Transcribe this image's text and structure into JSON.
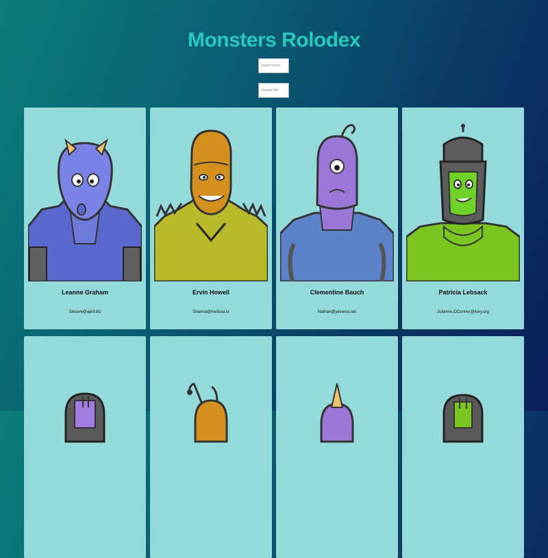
{
  "title": "Monsters Rolodex",
  "search": {
    "placeholder": "search monsters"
  },
  "title_input": {
    "placeholder": "change title"
  },
  "monsters": [
    {
      "name": "Leanne Graham",
      "email": "Sincere@april.biz",
      "color": "#7b83e6",
      "icon": "monster-blue-horned"
    },
    {
      "name": "Ervin Howell",
      "email": "Shanna@melissa.tv",
      "color": "#d4901e",
      "icon": "monster-orange-spiky"
    },
    {
      "name": "Clementine Bauch",
      "email": "Nathan@yesenia.net",
      "color": "#9b78d8",
      "icon": "monster-purple-cyclops"
    },
    {
      "name": "Patricia Lebsack",
      "email": "Julianne.OConner@kory.org",
      "color": "#7ac520",
      "icon": "monster-green-helmet"
    }
  ],
  "colors": {
    "background_start": "#0a7d7a",
    "background_end": "#0a1f5a",
    "title": "#27c9bf",
    "card": "#95dada"
  }
}
